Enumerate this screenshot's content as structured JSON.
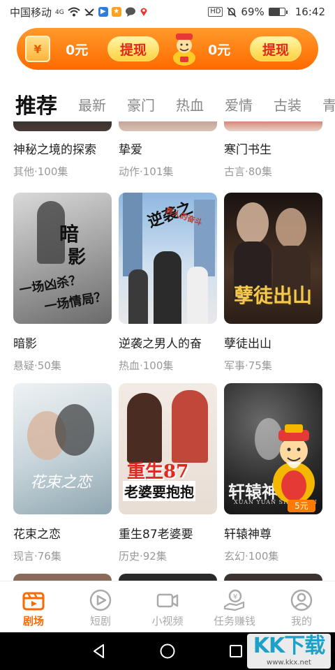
{
  "status_bar": {
    "carrier": "中国移动",
    "network": "4G",
    "battery": "69%",
    "battery_fraction": 0.69,
    "time": "16:42",
    "hd": "HD"
  },
  "reward_banner": {
    "wallet_glyph": "¥",
    "amount_left": "0元",
    "withdraw_left": "提现",
    "amount_right": "0元",
    "withdraw_right": "提现"
  },
  "tabs": [
    {
      "label": "推荐"
    },
    {
      "label": "最新"
    },
    {
      "label": "豪门"
    },
    {
      "label": "热血"
    },
    {
      "label": "爱情"
    },
    {
      "label": "古装"
    },
    {
      "label": "青"
    }
  ],
  "dramas": [
    {
      "title": "神秘之境的探索",
      "meta": "其他·100集"
    },
    {
      "title": "挚爱",
      "meta": "动作·101集"
    },
    {
      "title": "寒门书生",
      "meta": "古言·80集"
    },
    {
      "title": "暗影",
      "meta": "悬疑·50集",
      "poster_text_1": "暗",
      "poster_text_2": "影",
      "poster_text_3": "一场凶杀？",
      "poster_text_4": "一场情局？"
    },
    {
      "title": "逆袭之男人的奋",
      "meta": "热血·100集",
      "poster_text_1": "逆袭之",
      "poster_text_2": "男人的奋斗"
    },
    {
      "title": "孽徒出山",
      "meta": "军事·75集",
      "poster_text_1": "孽徒出山"
    },
    {
      "title": "花束之恋",
      "meta": "现言·76集",
      "poster_text_1": "花束之恋"
    },
    {
      "title": "重生87老婆要",
      "meta": "历史·92集",
      "poster_text_1": "重生87",
      "poster_text_2": "老婆要抱抱"
    },
    {
      "title": "轩辕神尊",
      "meta": "玄幻·100集",
      "poster_text_1": "轩辕神尊",
      "poster_text_2": "XUAN YUAN SHEN ZUN"
    }
  ],
  "floating_reward": {
    "price": "5元"
  },
  "bottom_nav": [
    {
      "label": "剧场",
      "icon": "theater-icon"
    },
    {
      "label": "短剧",
      "icon": "play-circle-icon"
    },
    {
      "label": "小视频",
      "icon": "video-camera-icon"
    },
    {
      "label": "任务赚钱",
      "icon": "coin-hand-icon"
    },
    {
      "label": "我的",
      "icon": "user-icon"
    }
  ],
  "watermark": {
    "main": "KK下载",
    "sub": "www.kkx.net"
  },
  "colors": {
    "accent": "#ff6a00",
    "withdraw_text": "#e0281e"
  }
}
